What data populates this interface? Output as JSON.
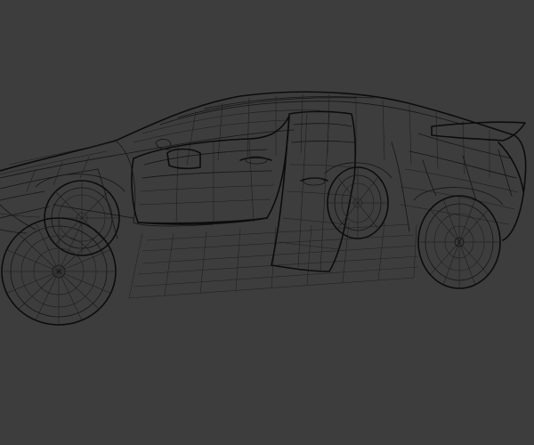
{
  "viewport": {
    "background_color": "#3d3d3d",
    "wire_color": "#151515",
    "shading_mode": "wireframe"
  },
  "model": {
    "type": "car",
    "parts": [
      "body",
      "open-front-door",
      "open-rear-door",
      "rear-spoiler",
      "wheels"
    ]
  }
}
